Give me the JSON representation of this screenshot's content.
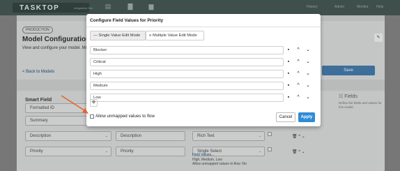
{
  "navbar": {
    "logo": "TASKTOP",
    "logo_sub": "Integration Hub",
    "items": [
      "History",
      "Admin",
      "Monitor",
      "Help",
      "Settings"
    ]
  },
  "page": {
    "tag": "PRODUCTION",
    "title": "Model Configuration",
    "description": "View and configure your model. Mo",
    "back_link": "< Back to Models",
    "save_label": "Save",
    "smart_field_header": "Smart Field",
    "fields_panel": {
      "title": "Fields",
      "description": "Define the fields and values for this model."
    },
    "rows": [
      {
        "left": "Formatted ID"
      },
      {
        "left": "Summary"
      },
      {
        "left": "Description",
        "middle": "Description",
        "type": "Rich Text"
      },
      {
        "left": "Priority",
        "middle": "Priority",
        "type": "Single Select"
      }
    ],
    "mapping": {
      "link": "Field Values...",
      "values": "High, Medium, Low",
      "allow": "Allow unmapped values to flow: No"
    }
  },
  "dialog": {
    "title": "Configure Field Values for Priority",
    "mode_single": "Single Value Edit Mode",
    "mode_multiple": "Multiple Value Edit Mode",
    "values": [
      "Blocker",
      "Critical",
      "High",
      "Medium",
      "Low"
    ],
    "allow_unmapped_label": "Allow unmapped values to flow",
    "allow_unmapped_checked": false,
    "cancel_label": "Cancel",
    "apply_label": "Apply"
  },
  "colors": {
    "navbar": "#3f4f4c",
    "apply": "#2e8bd6",
    "arrow": "#e8622c",
    "save": "#3e6e9a"
  }
}
